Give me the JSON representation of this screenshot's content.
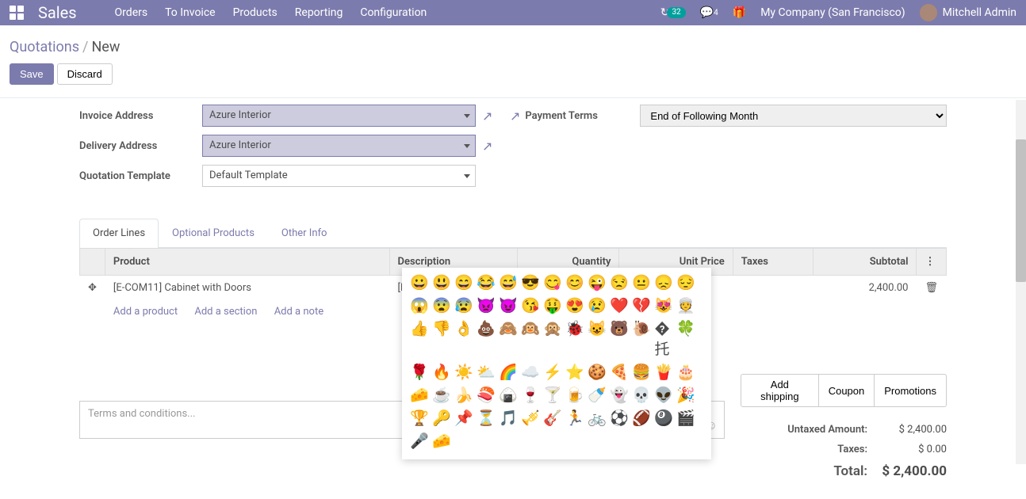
{
  "nav": {
    "brand": "Sales",
    "menu": [
      "Orders",
      "To Invoice",
      "Products",
      "Reporting",
      "Configuration"
    ],
    "timer_badge": "32",
    "msg_badge": "4",
    "company": "My Company (San Francisco)",
    "user": "Mitchell Admin"
  },
  "breadcrumb": {
    "root": "Quotations",
    "current": "New"
  },
  "buttons": {
    "save": "Save",
    "discard": "Discard"
  },
  "form": {
    "invoice_address_label": "Invoice Address",
    "invoice_address": "Azure Interior",
    "delivery_address_label": "Delivery Address",
    "delivery_address": "Azure Interior",
    "template_label": "Quotation Template",
    "template": "Default Template",
    "payment_terms_label": "Payment Terms",
    "payment_terms": "End of Following Month"
  },
  "tabs": {
    "order_lines": "Order Lines",
    "optional": "Optional Products",
    "other": "Other Info"
  },
  "table": {
    "headers": {
      "product": "Product",
      "description": "Description",
      "quantity": "Quantity",
      "unit_price": "Unit Price",
      "taxes": "Taxes",
      "subtotal": "Subtotal"
    },
    "row": {
      "product": "[E-COM11]  Cabinet with Doors",
      "description": "[E-CO",
      "subtotal": "2,400.00"
    },
    "add": {
      "product": "Add a product",
      "section": "Add a section",
      "note": "Add a note"
    }
  },
  "actions": {
    "shipping": "Add shipping",
    "coupon": "Coupon",
    "promotions": "Promotions"
  },
  "terms_placeholder": "Terms and conditions...",
  "totals": {
    "untaxed_label": "Untaxed Amount:",
    "untaxed": "$ 2,400.00",
    "taxes_label": "Taxes:",
    "taxes": "$ 0.00",
    "total_label": "Total:",
    "total": "$ 2,400.00"
  },
  "emoji": [
    "😀",
    "😃",
    "😄",
    "😂",
    "😅",
    "😎",
    "😋",
    "😊",
    "😜",
    "😒",
    "😐",
    "😞",
    "😔",
    "😱",
    "😨",
    "😰",
    "👿",
    "😈",
    "😘",
    "🤑",
    "😍",
    "😢",
    "❤️",
    "💔",
    "😻",
    "👳",
    "👍",
    "👎",
    "👌",
    "💩",
    "🙈",
    "🙉",
    "🙊",
    "🐞",
    "😺",
    "🐻",
    "🐌",
    "�托",
    "🍀",
    "🌹",
    "🔥",
    "☀️",
    "⛅",
    "🌈",
    "☁️",
    "⚡",
    "⭐",
    "🍪",
    "🍕",
    "🍔",
    "🍟",
    "🎂",
    "🧀",
    "☕",
    "🍌",
    "🍣",
    "🍙",
    "🍷",
    "🍸",
    "🍺",
    "🍼",
    "👻",
    "💀",
    "👽",
    "🎉",
    "🏆",
    "🔑",
    "📌",
    "⏳",
    "🎵",
    "🎺",
    "🎸",
    "🏃",
    "🚲",
    "⚽",
    "🏈",
    "🎱",
    "🎬",
    "🎤",
    "🧀"
  ]
}
